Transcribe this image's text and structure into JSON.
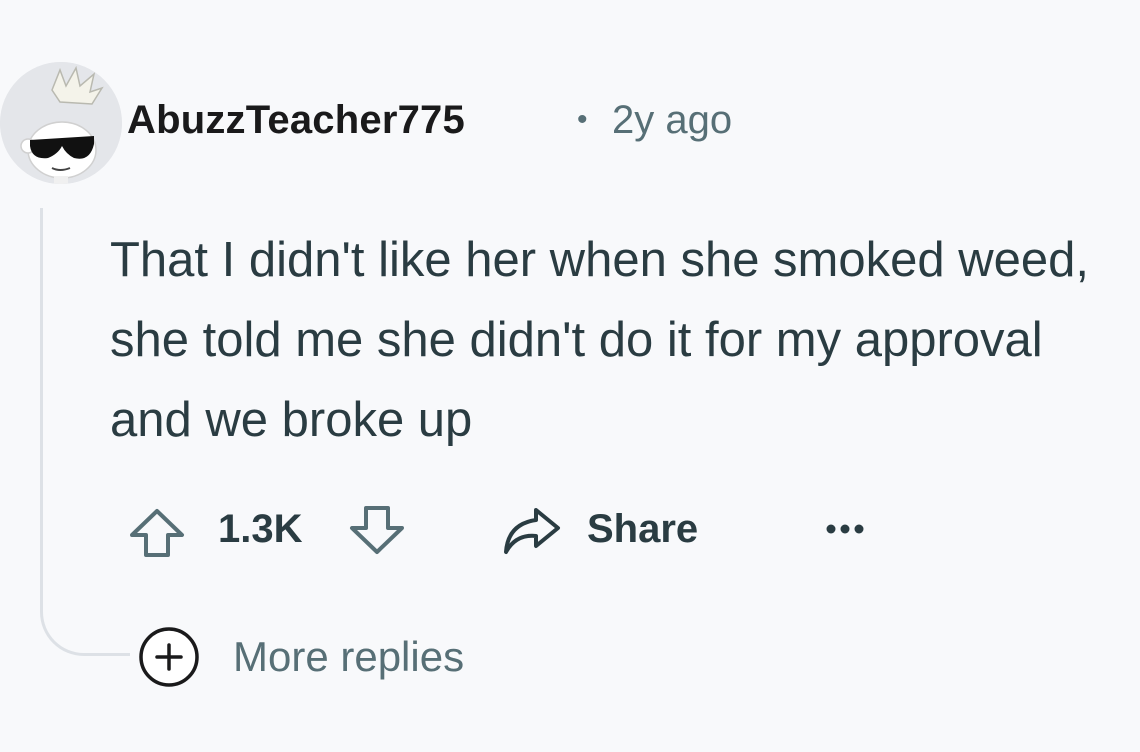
{
  "comment": {
    "author": "AbuzzTeacher775",
    "separator": "•",
    "timestamp": "2y ago",
    "text": "That I didn't like her when she smoked weed, she told me she didn't do it for my approval and we broke up"
  },
  "actions": {
    "upvote_icon": "arrow-up-outline-icon",
    "vote_count": "1.3K",
    "downvote_icon": "arrow-down-outline-icon",
    "share_icon": "share-arrow-icon",
    "share_label": "Share",
    "more_icon": "ellipsis-icon"
  },
  "replies": {
    "expand_icon": "plus-circle-icon",
    "label": "More replies"
  },
  "colors": {
    "background": "#f8f9fb",
    "text": "#2a3c42",
    "muted": "#576f76",
    "thread_line": "#dde1e6"
  }
}
